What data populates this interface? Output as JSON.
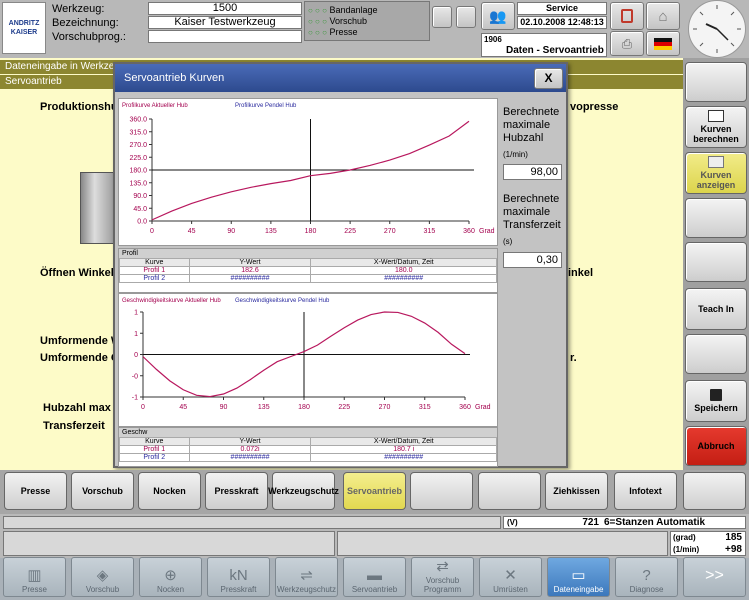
{
  "header": {
    "brand": "ANDRITZ KAISER",
    "labels": {
      "werkzeug": "Werkzeug:",
      "bezeichnung": "Bezeichnung:",
      "vorschubprog": "Vorschubprog.:"
    },
    "werkzeug_value": "1500",
    "bezeichnung_value": "Kaiser Testwerkzeug",
    "vorschubprog_value": "",
    "status": [
      "Bandanlage",
      "Vorschub",
      "Presse"
    ],
    "user": "Service",
    "datetime": "02.10.2008 12:48:13",
    "screen_no": "1906",
    "screen_title": "Daten - Servoantrieb"
  },
  "page": {
    "title": "Dateneingabe in Werkzeug",
    "subtitle": "Servoantrieb",
    "left_labels": [
      "Produktionshub",
      "Öffnen Winkel",
      "Umformende Wi",
      "Umformende Ge",
      "Hubzahl max",
      "Transferzeit"
    ],
    "right_labels": [
      "vopresse",
      "inkel",
      "r."
    ]
  },
  "dialog": {
    "title": "Servoantrieb Kurven",
    "close": "X",
    "hubzahl_label": "Berechnete maximale Hubzahl",
    "hubzahl_unit": "(1/min)",
    "hubzahl_value": "98,00",
    "transfer_label": "Berechnete maximale Transferzeit",
    "transfer_unit": "(s)",
    "transfer_value": "0,30",
    "chart1_legend": [
      "Profilkurve Aktueller Hub",
      "Profilkurve Pendel Hub"
    ],
    "chart2_legend": [
      "Geschwindigkeitskurve Aktueller Hub",
      "Geschwindigkeitskurve Pendel Hub"
    ],
    "x_unit": "Grad",
    "table1": {
      "title": "Profil",
      "headers": [
        "Kurve",
        "Y-Wert",
        "X-Wert/Datum, Zeit"
      ],
      "rows": [
        [
          "Profil 1",
          "182.6",
          "180.0"
        ],
        [
          "Profil 2",
          "##########",
          "##########"
        ]
      ]
    },
    "table2": {
      "title": "Geschw",
      "headers": [
        "Kurve",
        "Y-Wert",
        "X-Wert/Datum, Zeit"
      ],
      "rows": [
        [
          "Profil 1",
          "0.072i",
          "180.7 i"
        ],
        [
          "Profil 2",
          "##########",
          "##########"
        ]
      ]
    }
  },
  "chart_data": [
    {
      "type": "line",
      "series": [
        {
          "name": "Profilkurve Aktueller Hub",
          "x": [
            0,
            22.5,
            45,
            67.5,
            90,
            112.5,
            135,
            157.5,
            180,
            202.5,
            225,
            247.5,
            270,
            292.5,
            315,
            337.5,
            360
          ],
          "values": [
            4,
            35,
            62,
            84,
            103,
            119,
            132,
            143,
            160,
            168,
            180,
            196,
            215,
            238,
            268,
            300,
            352
          ]
        }
      ],
      "x_ticks": [
        "0",
        "45",
        "90",
        "135",
        "180",
        "225",
        "270",
        "315",
        "360"
      ],
      "y_ticks": [
        "360.0",
        "315.0",
        "270.0",
        "225.0",
        "180.0",
        "135.0",
        "90.0",
        "45.0",
        "0.0"
      ],
      "xlabel": "Grad",
      "xlim": [
        0,
        360
      ],
      "ylim": [
        0,
        360
      ]
    },
    {
      "type": "line",
      "series": [
        {
          "name": "Geschwindigkeitskurve Aktueller Hub",
          "x": [
            0,
            15,
            30,
            45,
            60,
            75,
            90,
            105,
            120,
            135,
            150,
            165,
            180,
            195,
            210,
            225,
            240,
            255,
            270,
            285,
            300,
            315,
            330,
            345,
            360
          ],
          "values": [
            -0.05,
            -0.35,
            -0.62,
            -0.83,
            -0.96,
            -0.99,
            -0.93,
            -0.79,
            -0.59,
            -0.37,
            -0.17,
            -0.05,
            0.07,
            0.22,
            0.43,
            0.63,
            0.81,
            0.94,
            1.0,
            0.99,
            0.9,
            0.74,
            0.52,
            0.24,
            0.02
          ]
        }
      ],
      "x_ticks": [
        "0",
        "45",
        "90",
        "135",
        "180",
        "225",
        "270",
        "315",
        "360"
      ],
      "y_ticks": [
        "1",
        "1",
        "0",
        "-0",
        "-1"
      ],
      "xlabel": "Grad",
      "xlim": [
        0,
        360
      ],
      "ylim": [
        -1,
        1
      ]
    }
  ],
  "side_buttons": [
    "Kurven berechnen",
    "Kurven anzeigen",
    "",
    "Teach In",
    "",
    "Speichern",
    "Abbruch"
  ],
  "nav": [
    "Presse",
    "Vorschub",
    "Nocken",
    "Presskraft",
    "Werkzeugschutz",
    "Servoantrieb",
    "",
    "",
    "Ziehkissen",
    "Infotext",
    ""
  ],
  "status_bar": {
    "unit1": "(V)",
    "val1": "721",
    "mode": "6=Stanzen Automatik",
    "unit2": "(grad)",
    "val2": "185",
    "unit3": "(1/min)",
    "val3": "+98"
  },
  "bottom_nav": [
    "Presse",
    "Vorschub",
    "Nocken",
    "Presskraft",
    "Werkzeugschutz",
    "Servoantrieb",
    "Vorschub Programm",
    "Umrüsten",
    "Dateneingabe",
    "Diagnose",
    ">>"
  ],
  "colors": {
    "page_bg": "#fdfbc8",
    "title_bar": "#8c8630",
    "dialog_header": "#3a5aa6",
    "accent_red": "#d9261c",
    "active_yellow": "#ece45c"
  }
}
